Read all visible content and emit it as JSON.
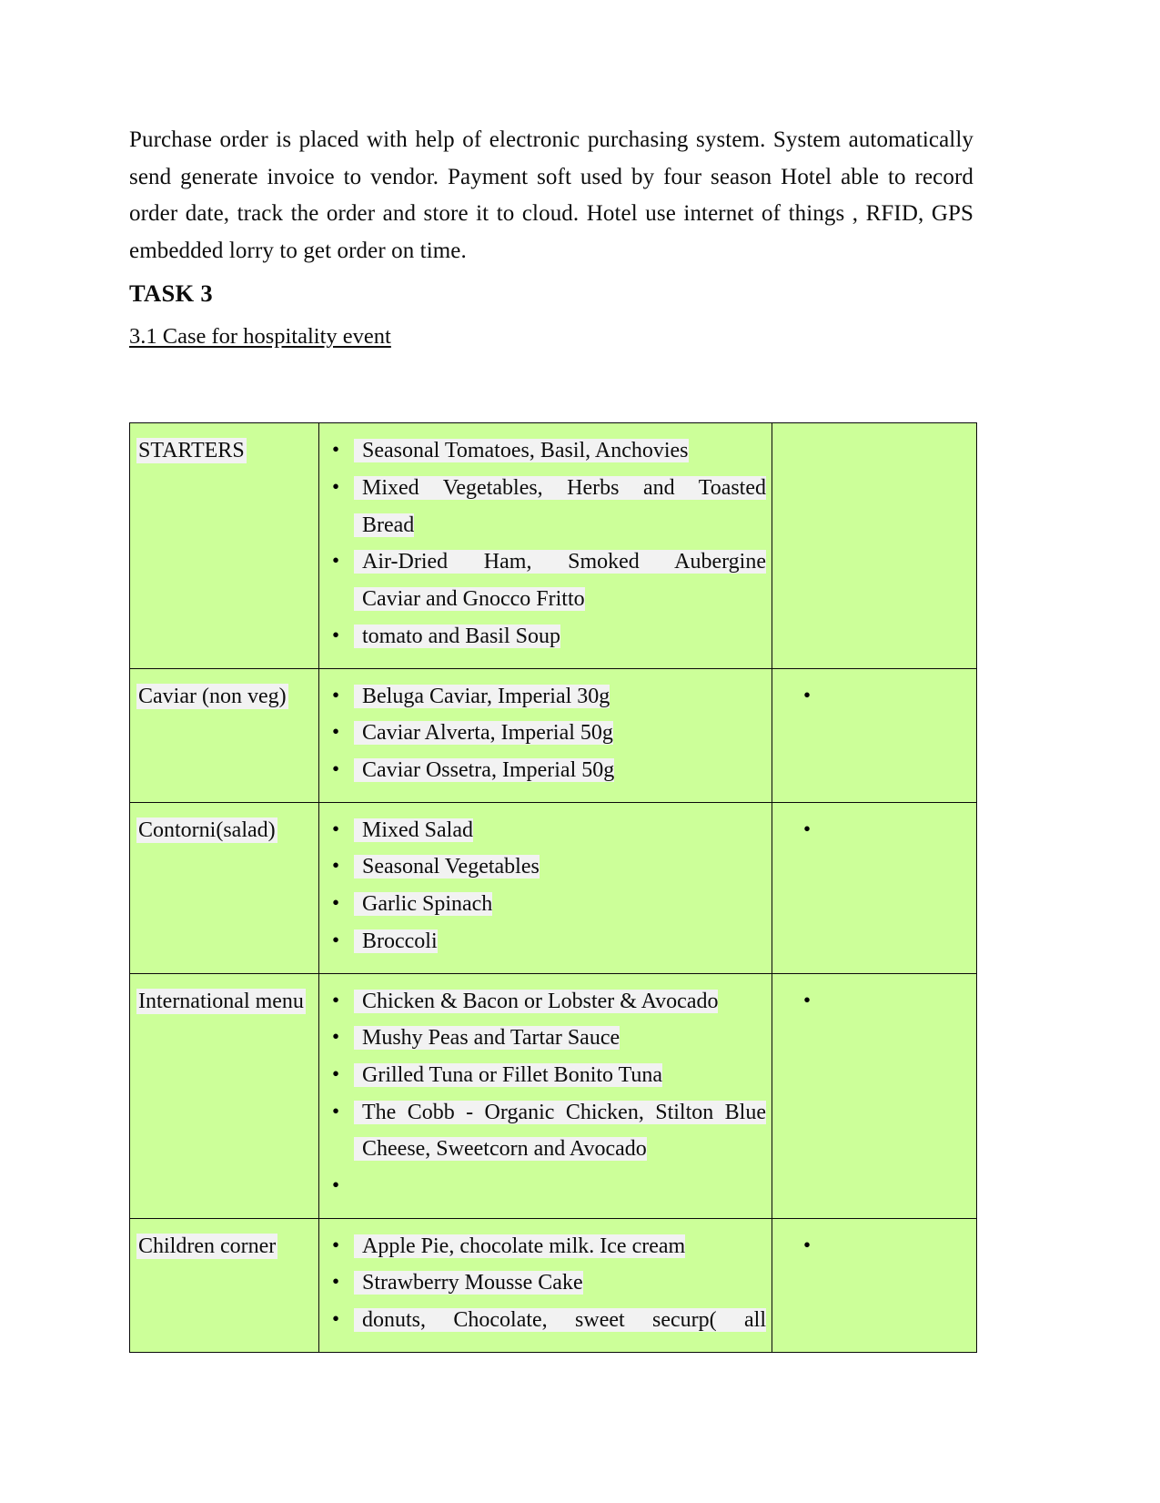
{
  "document": {
    "paragraph": "Purchase order is placed with help of electronic purchasing system. System automatically send generate invoice to vendor.  Payment soft used by four season Hotel able to record order date, track the order and store it to cloud. Hotel use internet of things , RFID, GPS embedded lorry to get order on time.",
    "task_heading": "TASK 3",
    "section_heading": "3.1 Case for hospitality event"
  },
  "theme": {
    "table_fill": "#ccff99",
    "highlight": "#f2f2f2",
    "border": "#0a0a0a",
    "text": "#0d0d0d",
    "page_background": "#ffffff"
  },
  "menu_table": {
    "rows": [
      {
        "category": "STARTERS",
        "category_spread": false,
        "items": [
          {
            "lines": [
              "Seasonal Tomatoes, Basil, Anchovies"
            ],
            "spread": [
              false
            ]
          },
          {
            "lines": [
              "Mixed   Vegetables,   Herbs   and Toasted",
              "Bread"
            ],
            "spread": [
              true,
              false
            ]
          },
          {
            "lines": [
              "Air-Dried    Ham,    Smoked    Aubergine",
              "Caviar and Gnocco Fritto"
            ],
            "spread": [
              true,
              false
            ]
          },
          {
            "lines": [
              "tomato and Basil Soup"
            ],
            "spread": [
              false
            ]
          }
        ],
        "note_bullets": 0
      },
      {
        "category": "Caviar (non veg)",
        "category_spread": false,
        "items": [
          {
            "lines": [
              "Beluga Caviar, Imperial 30g"
            ],
            "spread": [
              false
            ]
          },
          {
            "lines": [
              "Caviar Alverta, Imperial 50g"
            ],
            "spread": [
              false
            ]
          },
          {
            "lines": [
              "Caviar Ossetra, Imperial 50g"
            ],
            "spread": [
              false
            ]
          }
        ],
        "note_bullets": 1
      },
      {
        "category": "Contorni(salad)",
        "category_spread": false,
        "items": [
          {
            "lines": [
              "Mixed Salad"
            ],
            "spread": [
              false
            ]
          },
          {
            "lines": [
              "Seasonal Vegetables"
            ],
            "spread": [
              false
            ]
          },
          {
            "lines": [
              "Garlic Spinach"
            ],
            "spread": [
              false
            ]
          },
          {
            "lines": [
              "Broccoli"
            ],
            "spread": [
              false
            ]
          }
        ],
        "note_bullets": 1
      },
      {
        "category": "International  menu",
        "category_spread": true,
        "items": [
          {
            "lines": [
              "Chicken & Bacon or Lobster & Avocado"
            ],
            "spread": [
              false
            ]
          },
          {
            "lines": [
              "Mushy Peas and Tartar Sauce"
            ],
            "spread": [
              false
            ]
          },
          {
            "lines": [
              "Grilled Tuna or Fillet Bonito Tuna"
            ],
            "spread": [
              false
            ]
          },
          {
            "lines": [
              "The Cobb - Organic Chicken, Stilton Blue",
              "Cheese, Sweetcorn and Avocado"
            ],
            "spread": [
              true,
              false
            ]
          },
          {
            "lines": [
              ""
            ],
            "spread": [
              false
            ],
            "blank": true
          }
        ],
        "note_bullets": 1
      },
      {
        "category": "Children corner",
        "category_spread": false,
        "items": [
          {
            "lines": [
              "Apple Pie, chocolate milk. Ice cream"
            ],
            "spread": [
              false
            ]
          },
          {
            "lines": [
              "Strawberry Mousse Cake"
            ],
            "spread": [
              false
            ]
          },
          {
            "lines": [
              "donuts,   Chocolate,   sweet   securp(   all"
            ],
            "spread": [
              true
            ]
          }
        ],
        "note_bullets": 1
      }
    ]
  }
}
